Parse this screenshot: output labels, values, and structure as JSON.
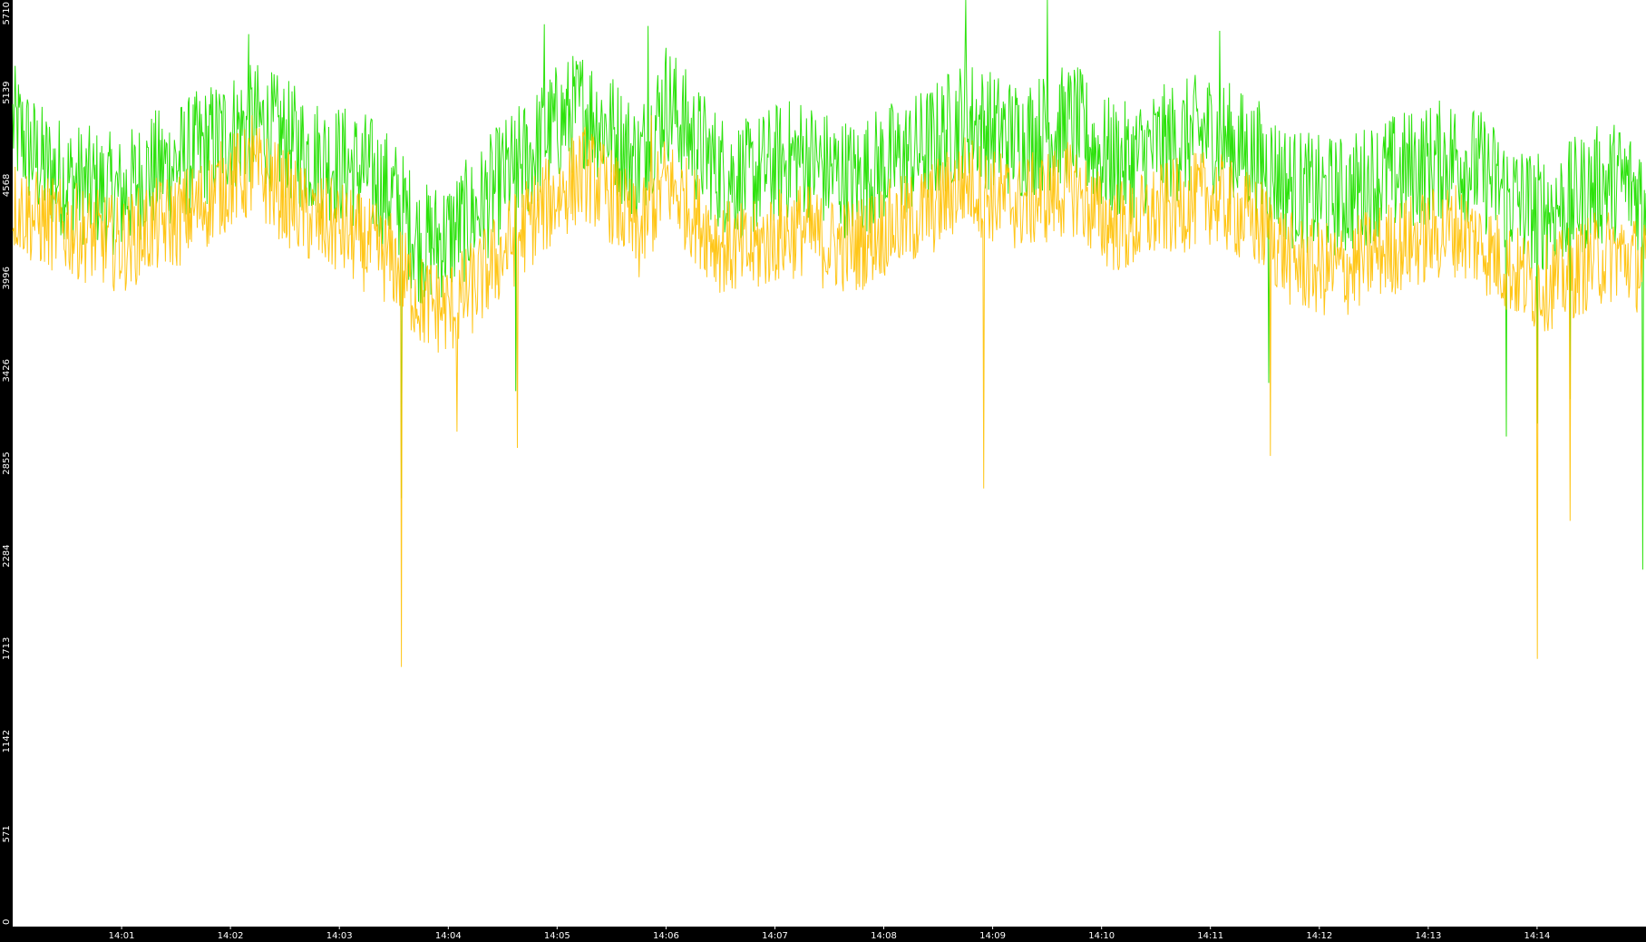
{
  "chart_data": {
    "type": "line",
    "title": "",
    "xlabel": "",
    "ylabel": "",
    "ylim": [
      0,
      5710
    ],
    "xlim": [
      "14:00:00",
      "14:15:00"
    ],
    "y_ticks": [
      "0",
      "571",
      "1142",
      "1713",
      "2284",
      "2855",
      "3426",
      "3996",
      "4568",
      "5139",
      "5710"
    ],
    "x_ticks": [
      "14:01",
      "14:02",
      "14:03",
      "14:04",
      "14:05",
      "14:06",
      "14:07",
      "14:08",
      "14:09",
      "14:10",
      "14:11",
      "14:12",
      "14:13",
      "14:14"
    ],
    "grid": false,
    "legend": "none",
    "colors": {
      "background": "#ffffff",
      "axis_band": "#000000",
      "tick_text": "#ffffff"
    },
    "series": [
      {
        "color": "#22e000",
        "x": [
          "14:00:00",
          "14:00:15",
          "14:00:30",
          "14:00:45",
          "14:01:00",
          "14:01:15",
          "14:01:30",
          "14:01:45",
          "14:02:00",
          "14:02:15",
          "14:02:30",
          "14:02:45",
          "14:03:00",
          "14:03:15",
          "14:03:30",
          "14:03:45",
          "14:04:00",
          "14:04:15",
          "14:04:30",
          "14:04:45",
          "14:05:00",
          "14:05:15",
          "14:05:30",
          "14:05:45",
          "14:06:00",
          "14:06:15",
          "14:06:30",
          "14:06:45",
          "14:07:00",
          "14:07:15",
          "14:07:30",
          "14:07:45",
          "14:08:00",
          "14:08:15",
          "14:08:30",
          "14:08:45",
          "14:09:00",
          "14:09:15",
          "14:09:30",
          "14:09:45",
          "14:10:00",
          "14:10:15",
          "14:10:30",
          "14:10:45",
          "14:11:00",
          "14:11:15",
          "14:11:30",
          "14:11:45",
          "14:12:00",
          "14:12:15",
          "14:12:30",
          "14:12:45",
          "14:13:00",
          "14:13:15",
          "14:13:30",
          "14:13:45",
          "14:14:00",
          "14:14:15",
          "14:14:30",
          "14:14:45",
          "14:15:00"
        ],
        "values": [
          4950,
          4700,
          4600,
          4550,
          4500,
          4650,
          4700,
          4800,
          4900,
          4950,
          4850,
          4750,
          4700,
          4650,
          4500,
          4200,
          4250,
          4400,
          4600,
          4750,
          4950,
          5050,
          4900,
          4700,
          5100,
          4850,
          4650,
          4600,
          4700,
          4750,
          4650,
          4600,
          4700,
          4750,
          4850,
          5000,
          4900,
          4850,
          4900,
          4950,
          4750,
          4700,
          4800,
          4850,
          4900,
          4800,
          4700,
          4550,
          4500,
          4500,
          4600,
          4650,
          4700,
          4750,
          4650,
          4500,
          4400,
          4450,
          4550,
          4600,
          4500
        ],
        "min_spikes": [
          {
            "x": "14:03:34",
            "value": 2640
          },
          {
            "x": "14:04:37",
            "value": 3300
          },
          {
            "x": "14:11:32",
            "value": 3350
          },
          {
            "x": "14:13:43",
            "value": 3020
          },
          {
            "x": "14:14:00",
            "value": 3100
          },
          {
            "x": "14:14:18",
            "value": 3250
          },
          {
            "x": "14:14:58",
            "value": 2200
          }
        ],
        "max_spikes": [
          {
            "x": "14:08:45",
            "value": 5710
          },
          {
            "x": "14:09:30",
            "value": 5710
          },
          {
            "x": "14:04:53",
            "value": 5560
          },
          {
            "x": "14:05:50",
            "value": 5550
          },
          {
            "x": "14:02:10",
            "value": 5500
          },
          {
            "x": "14:11:05",
            "value": 5520
          }
        ]
      },
      {
        "color": "#ffc000",
        "x": [
          "14:00:00",
          "14:00:15",
          "14:00:30",
          "14:00:45",
          "14:01:00",
          "14:01:15",
          "14:01:30",
          "14:01:45",
          "14:02:00",
          "14:02:15",
          "14:02:30",
          "14:02:45",
          "14:03:00",
          "14:03:15",
          "14:03:30",
          "14:03:45",
          "14:04:00",
          "14:04:15",
          "14:04:30",
          "14:04:45",
          "14:05:00",
          "14:05:15",
          "14:05:30",
          "14:05:45",
          "14:06:00",
          "14:06:15",
          "14:06:30",
          "14:06:45",
          "14:07:00",
          "14:07:15",
          "14:07:30",
          "14:07:45",
          "14:08:00",
          "14:08:15",
          "14:08:30",
          "14:08:45",
          "14:09:00",
          "14:09:15",
          "14:09:30",
          "14:09:45",
          "14:10:00",
          "14:10:15",
          "14:10:30",
          "14:10:45",
          "14:11:00",
          "14:11:15",
          "14:11:30",
          "14:11:45",
          "14:12:00",
          "14:12:15",
          "14:12:30",
          "14:12:45",
          "14:13:00",
          "14:13:15",
          "14:13:30",
          "14:13:45",
          "14:14:00",
          "14:14:15",
          "14:14:30",
          "14:14:45",
          "14:15:00"
        ],
        "values": [
          4450,
          4350,
          4300,
          4250,
          4200,
          4300,
          4350,
          4450,
          4600,
          4650,
          4500,
          4350,
          4300,
          4200,
          4100,
          3850,
          3800,
          3950,
          4150,
          4350,
          4500,
          4650,
          4500,
          4250,
          4600,
          4400,
          4200,
          4150,
          4250,
          4300,
          4200,
          4200,
          4300,
          4350,
          4450,
          4600,
          4500,
          4450,
          4500,
          4550,
          4350,
          4300,
          4400,
          4450,
          4500,
          4400,
          4300,
          4100,
          4050,
          4050,
          4150,
          4200,
          4250,
          4300,
          4200,
          4050,
          3950,
          4000,
          4100,
          4150,
          4050
        ],
        "min_spikes": [
          {
            "x": "14:03:34",
            "value": 1600
          },
          {
            "x": "14:08:55",
            "value": 2700
          },
          {
            "x": "14:11:33",
            "value": 2900
          },
          {
            "x": "14:14:00",
            "value": 1650
          },
          {
            "x": "14:14:18",
            "value": 2500
          },
          {
            "x": "14:04:05",
            "value": 3050
          },
          {
            "x": "14:04:38",
            "value": 2950
          }
        ],
        "max_spikes": [
          {
            "x": "14:02:12",
            "value": 5000
          },
          {
            "x": "14:05:52",
            "value": 5000
          }
        ]
      }
    ]
  }
}
